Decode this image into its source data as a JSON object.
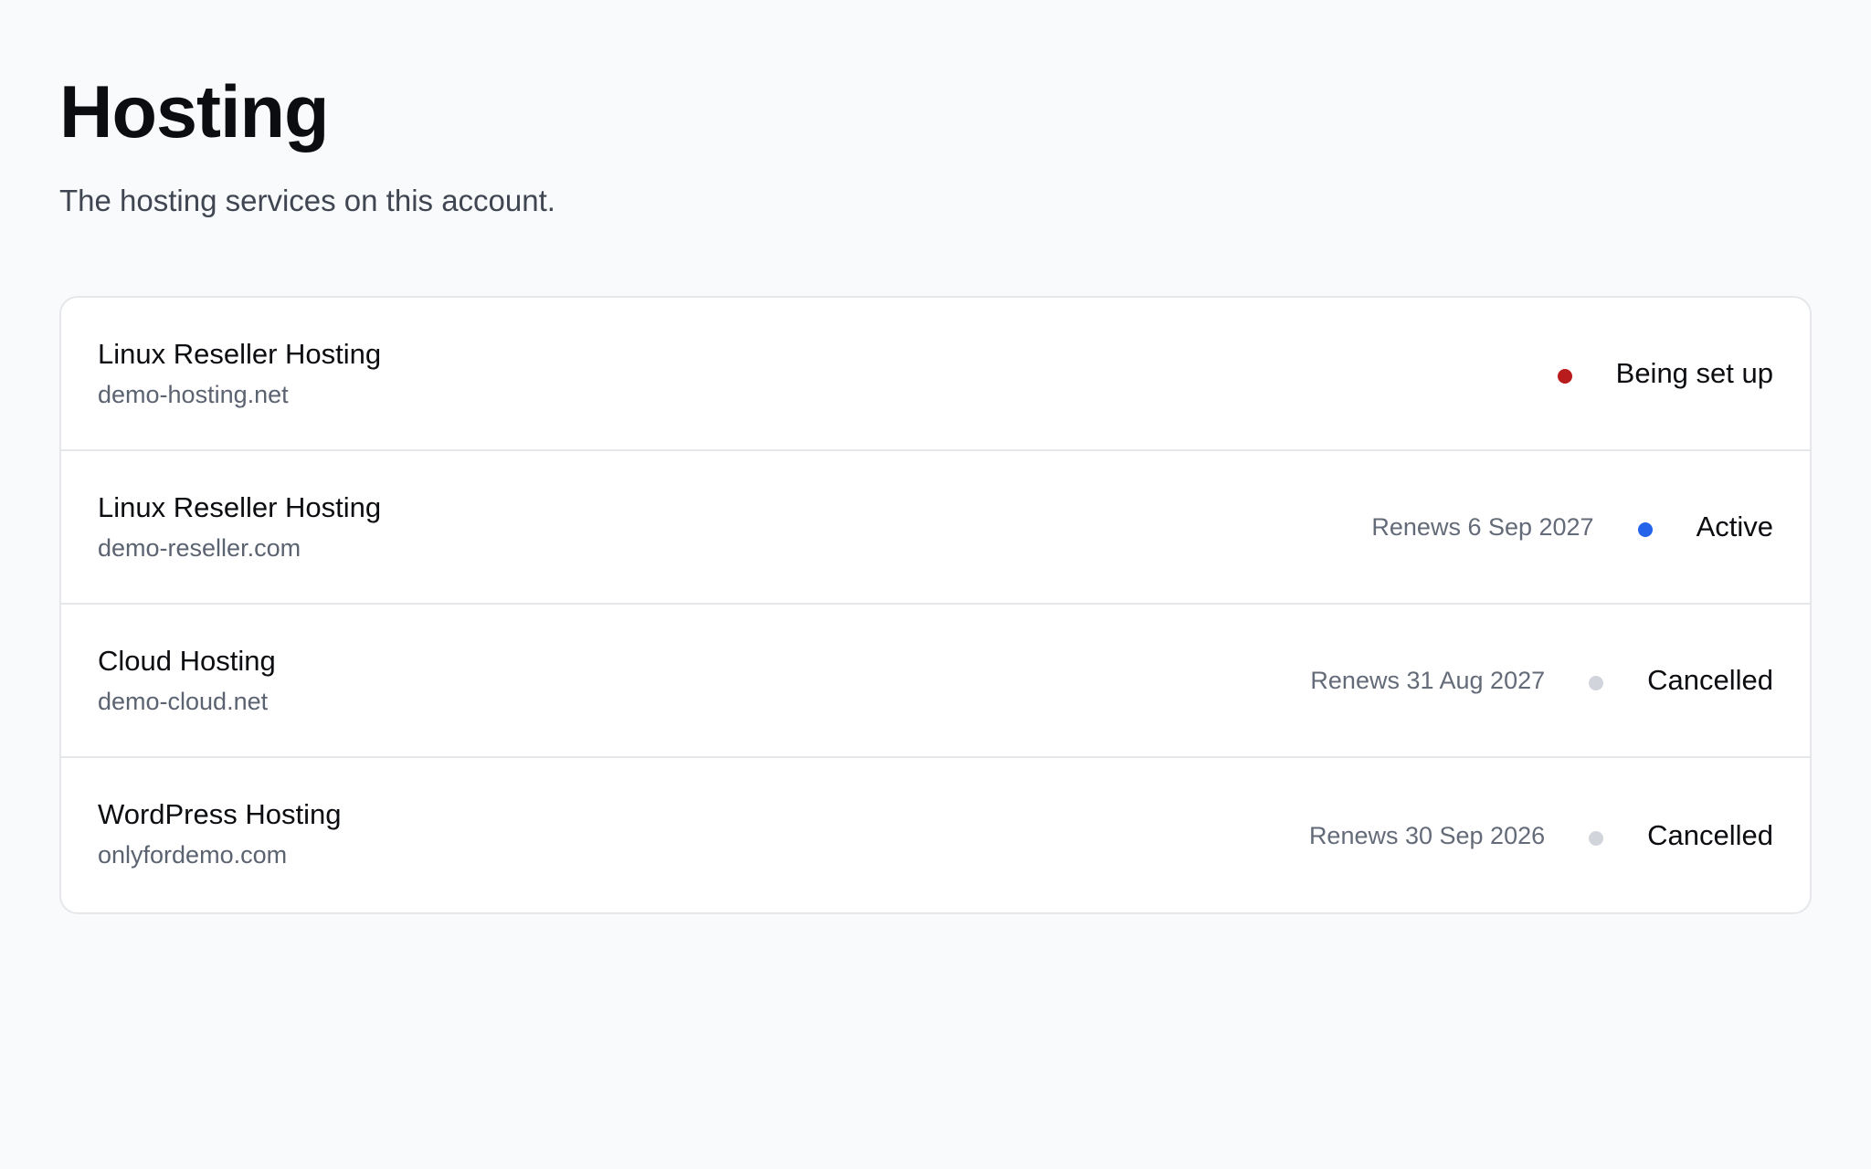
{
  "header": {
    "title": "Hosting",
    "subtitle": "The hosting services on this account."
  },
  "services": [
    {
      "name": "Linux Reseller Hosting",
      "domain": "demo-hosting.net",
      "renewal": "",
      "status": "Being set up",
      "status_color": "#b91c1c"
    },
    {
      "name": "Linux Reseller Hosting",
      "domain": "demo-reseller.com",
      "renewal": "Renews 6 Sep 2027",
      "status": "Active",
      "status_color": "#2563eb"
    },
    {
      "name": "Cloud Hosting",
      "domain": "demo-cloud.net",
      "renewal": "Renews 31 Aug 2027",
      "status": "Cancelled",
      "status_color": "#d1d5db"
    },
    {
      "name": "WordPress Hosting",
      "domain": "onlyfordemo.com",
      "renewal": "Renews 30 Sep 2026",
      "status": "Cancelled",
      "status_color": "#d1d5db"
    }
  ]
}
